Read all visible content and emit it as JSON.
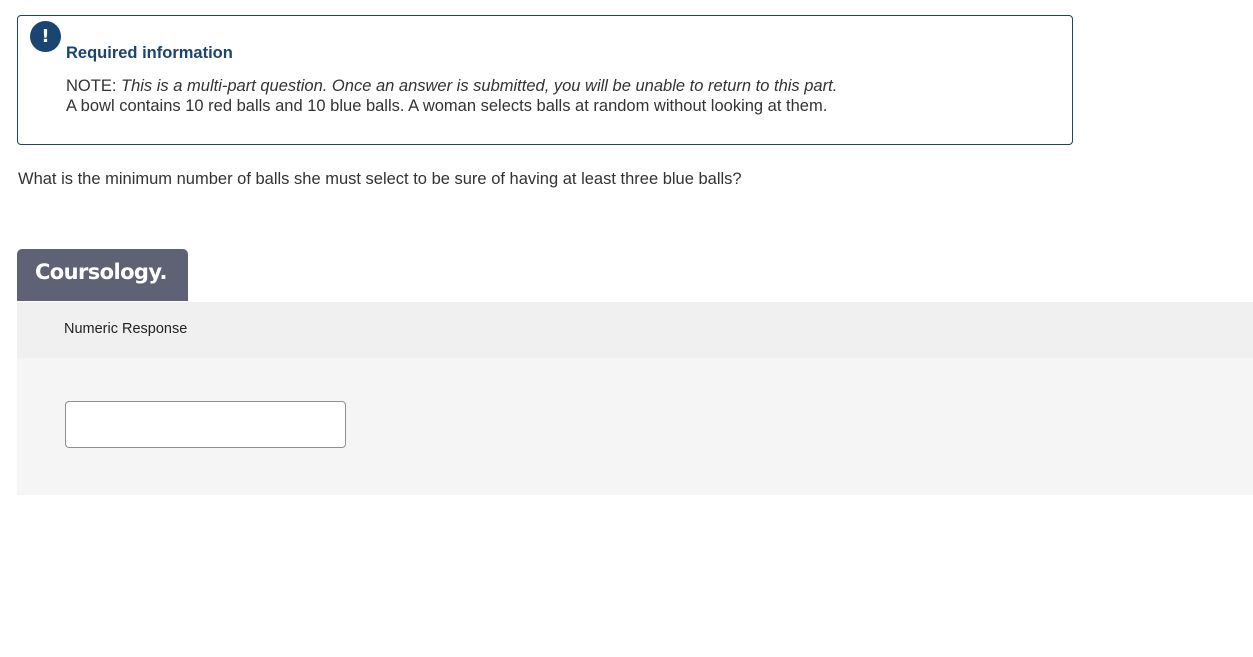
{
  "info": {
    "alert_icon": "!",
    "title": "Required information",
    "note_prefix": "NOTE:",
    "note_text": "This is a multi-part question. Once an answer is submitted, you will be unable to return to this part.",
    "context": "A bowl contains 10 red balls and 10 blue balls. A woman selects balls at random without looking at them."
  },
  "question": {
    "text": "What is the minimum number of balls she must select to be sure of having at least three blue balls?"
  },
  "brand": {
    "logo_text": "Coursology."
  },
  "response": {
    "label": "Numeric Response",
    "value": "",
    "placeholder": ""
  },
  "colors": {
    "accent": "#1a4472",
    "brand_tab": "#5f6275",
    "response_header_bg": "#f0f0f0",
    "response_body_bg": "#f5f5f5"
  }
}
